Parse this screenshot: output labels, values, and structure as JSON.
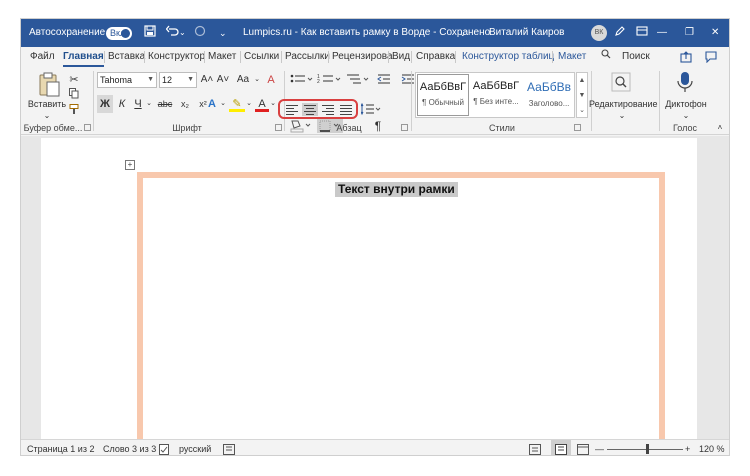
{
  "titlebar": {
    "autosave_label": "Автосохранение",
    "autosave_state": "Вкл",
    "doc_title": "Lumpics.ru - Как вставить рамку в Ворде  -  Сохранено",
    "title_dropdown": "⌄",
    "user_name": "Виталий Каиров",
    "user_initials": "ВК",
    "buttons": {
      "minimize": "—",
      "restore": "❐",
      "close": "✕"
    },
    "colors": {
      "bar": "#2b579a"
    }
  },
  "tabs": {
    "items": [
      "Файл",
      "Главная",
      "Вставка",
      "Конструктор",
      "Макет",
      "Ссылки",
      "Рассылки",
      "Рецензирова",
      "Вид",
      "Справка",
      "Конструктор таблиц",
      "Макет"
    ],
    "active": "Главная",
    "search_label": "Поиск"
  },
  "ribbon": {
    "clipboard": {
      "paste_label": "Вставить",
      "group_label": "Буфер обме..."
    },
    "font": {
      "font_name": "Tahoma",
      "font_size": "12",
      "grow": "A˄",
      "shrink": "A˅",
      "case": "Aa",
      "clear": "A",
      "bold": "Ж",
      "italic": "К",
      "underline": "Ч",
      "strike": "abc",
      "subscript": "x₂",
      "superscript": "x²",
      "effects": "A",
      "highlight": "✎",
      "color": "A",
      "group_label": "Шрифт"
    },
    "paragraph": {
      "group_label": "Абзац",
      "pilcrow": "¶"
    },
    "styles": {
      "items": [
        {
          "preview": "АаБбВвГ",
          "name": "¶ Обычный"
        },
        {
          "preview": "АаБбВвГ",
          "name": "¶ Без инте..."
        },
        {
          "preview": "АаБбВв",
          "name": "Заголово..."
        }
      ],
      "group_label": "Стили"
    },
    "editing": {
      "label": "Редактирование"
    },
    "voice": {
      "label": "Диктофон",
      "group_label": "Голос"
    }
  },
  "document": {
    "frame_text": "Текст внутри рамки",
    "frame_color": "#f8c8ad"
  },
  "status": {
    "page": "Страница 1 из 2",
    "words": "Слово 3 из 3",
    "language": "русский",
    "zoom": "120 %",
    "zoom_minus": "—",
    "zoom_plus": "+"
  },
  "icons": {
    "save": "floppy-icon",
    "undo": "undo-icon",
    "redo": "redo-icon",
    "search": "magnifier-icon",
    "pen": "pen-icon",
    "share": "share-icon",
    "comments": "comment-icon"
  }
}
